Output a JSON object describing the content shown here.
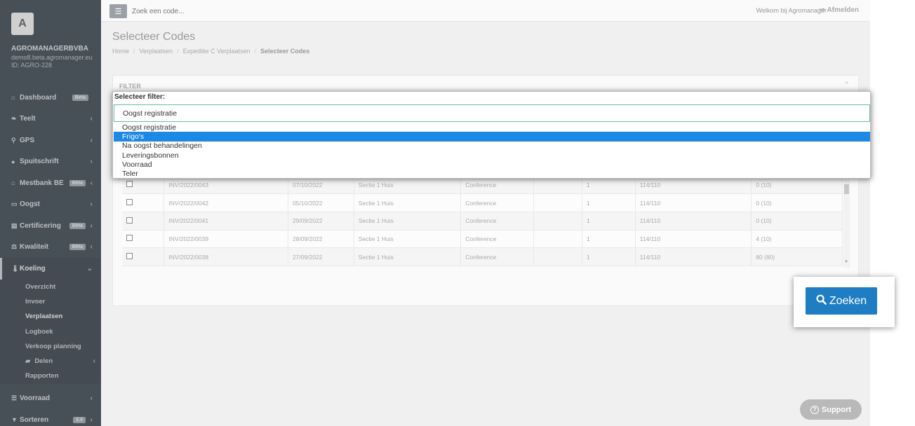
{
  "sidebar": {
    "avatar_letter": "A",
    "company": "AGROMANAGERBVBA",
    "email": "demo8.beta.agromanager.eu",
    "account_id": "ID: AGRO-228",
    "items": [
      {
        "label": "Dashboard",
        "icon": "home-icon",
        "badge": "Beta"
      },
      {
        "label": "Teelt",
        "icon": "leaf-icon"
      },
      {
        "label": "GPS",
        "icon": "map-pin-icon"
      },
      {
        "label": "Spuitschrift",
        "icon": "drop-icon"
      },
      {
        "label": "Mestbank BE",
        "icon": "bank-icon",
        "badge": "Bèta"
      },
      {
        "label": "Oogst",
        "icon": "basket-icon"
      },
      {
        "label": "Certificering",
        "icon": "certificate-icon",
        "badge": "Bèta"
      },
      {
        "label": "Kwaliteit",
        "icon": "scale-icon",
        "badge": "Bèta"
      },
      {
        "label": "Koeling",
        "icon": "thermometer-icon"
      }
    ],
    "submenu": [
      "Overzicht",
      "Invoer",
      "Verplaatsen",
      "Logboek",
      "Verkoop planning",
      "Delen",
      "Rapporten"
    ],
    "bottom_items": [
      {
        "label": "Voorraad",
        "icon": "list-icon"
      },
      {
        "label": "Sorteren",
        "icon": "filter-icon",
        "badge": "2.0"
      }
    ]
  },
  "topbar": {
    "search_placeholder": "Zoek een code...",
    "welcome": "Welkom bij Agromanager",
    "logout": "Afmelden"
  },
  "page": {
    "title": "Selecteer Codes",
    "breadcrumb": [
      "Home",
      "Verplaatsen",
      "Expeditie C Verplaatsen",
      "Selecteer Codes"
    ],
    "filter_header": "FILTER"
  },
  "table": {
    "rows": [
      [
        "INV/2022/0043",
        "07/10/2022",
        "Sectie 1 Huis",
        "Conference",
        "",
        "1",
        "114/110",
        "0 (10)"
      ],
      [
        "INV/2022/0042",
        "05/10/2022",
        "Sectie 1 Huis",
        "Conference",
        "",
        "1",
        "114/110",
        "0 (10)"
      ],
      [
        "INV/2022/0041",
        "29/09/2022",
        "Sectie 1 Huis",
        "Conference",
        "",
        "1",
        "114/110",
        "0 (10)"
      ],
      [
        "INV/2022/0039",
        "28/09/2022",
        "Sectie 1 Huis",
        "Conference",
        "",
        "1",
        "114/110",
        "4 (10)"
      ],
      [
        "INV/2022/0038",
        "27/09/2022",
        "Sectie 1 Huis",
        "Conference",
        "",
        "1",
        "114/110",
        "80 (80)"
      ]
    ]
  },
  "dropdown": {
    "label": "Selecteer filter:",
    "selected": "Oogst registratie",
    "options": [
      "Oogst registratie",
      "Frigo's",
      "Na oogst behandelingen",
      "Leveringsbonnen",
      "Voorraad",
      "Teler"
    ],
    "highlighted_index": 1
  },
  "search_button": "Zoeken",
  "support_button": "Support"
}
